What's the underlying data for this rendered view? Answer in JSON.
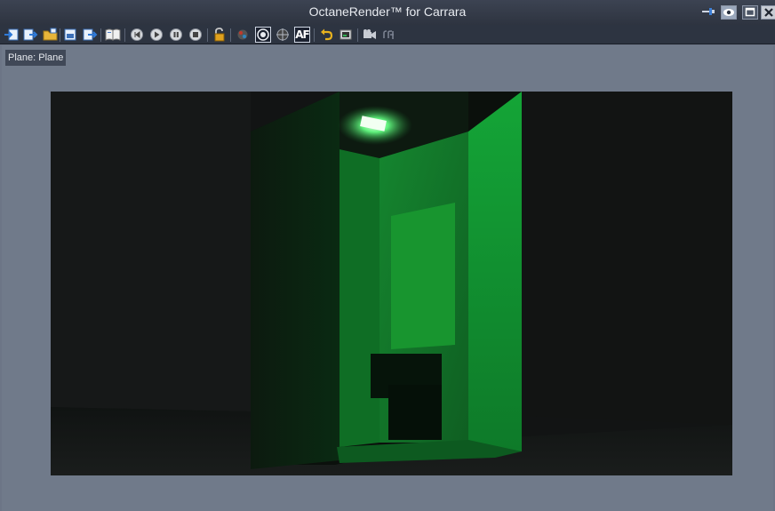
{
  "window": {
    "title": "OctaneRender™ for Carrara"
  },
  "title_buttons": {
    "pin_icon": "pin-icon",
    "eye_icon": "eye-icon",
    "maximize_icon": "maximize-icon",
    "close_icon": "close-icon"
  },
  "toolbar": {
    "af_label": "AF"
  },
  "viewport": {
    "label": "Plane: Plane"
  },
  "colors": {
    "titlebar": "#2e3440",
    "panel": "#707a8a",
    "green_light": "#1fae3e"
  }
}
